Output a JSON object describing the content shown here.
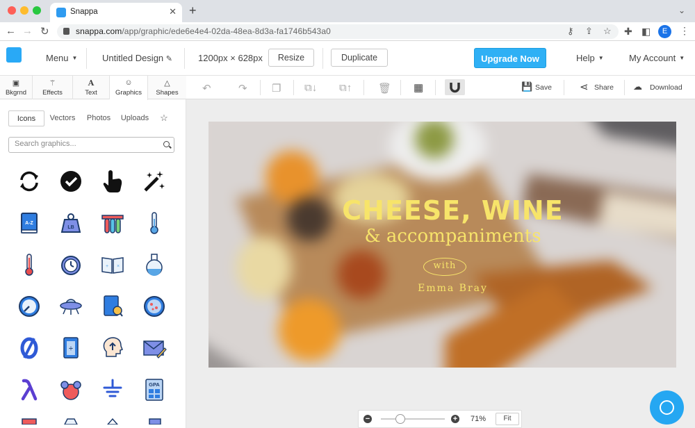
{
  "browser": {
    "tab_title": "Snappa",
    "url_host": "snappa.com",
    "url_path": "/app/graphic/ede6e4e4-02da-48ea-8d3a-fa1746b543a0",
    "profile_initial": "E"
  },
  "header": {
    "menu_label": "Menu",
    "design_name": "Untitled Design",
    "dimensions": "1200px × 628px",
    "resize_label": "Resize",
    "duplicate_label": "Duplicate",
    "upgrade_label": "Upgrade Now",
    "help_label": "Help",
    "account_label": "My Account"
  },
  "sidebar": {
    "tabs": [
      {
        "label": "Bkgrnd",
        "icon": "image-icon"
      },
      {
        "label": "Effects",
        "icon": "wand-icon"
      },
      {
        "label": "Text",
        "icon": "text-icon"
      },
      {
        "label": "Graphics",
        "icon": "smiley-icon"
      },
      {
        "label": "Shapes",
        "icon": "triangle-icon"
      }
    ],
    "active_tab": "Graphics",
    "subtabs": [
      "Icons",
      "Vectors",
      "Photos",
      "Uploads"
    ],
    "active_subtab": "Icons",
    "search_placeholder": "Search graphics...",
    "icons": [
      "refresh-icon",
      "check-circle-icon",
      "pointer-hand-icon",
      "magic-wand-icon",
      "dictionary-icon",
      "weight-icon",
      "test-tubes-icon",
      "thermometer-icon",
      "thermometer-hot-icon",
      "stopwatch-icon",
      "open-book-icon",
      "flask-icon",
      "gauge-icon",
      "ufo-icon",
      "book-search-icon",
      "petri-dish-icon",
      "empty-set-icon",
      "division-book-icon",
      "head-idea-icon",
      "envelope-pen-icon",
      "lambda-icon",
      "atom-icon",
      "ground-icon",
      "gpa-calculator-icon"
    ]
  },
  "toolbar": {
    "save_label": "Save",
    "share_label": "Share",
    "download_label": "Download"
  },
  "canvas": {
    "headline": "CHEESE, WINE",
    "subheadline": "& accompaniments",
    "with_label": "with",
    "author": "Emma Bray",
    "text_color": "#f7e46a"
  },
  "zoom": {
    "percent": "71%",
    "fit_label": "Fit"
  },
  "colors": {
    "accent": "#2fb0f5",
    "brand_purple": "#6d4fe0"
  }
}
